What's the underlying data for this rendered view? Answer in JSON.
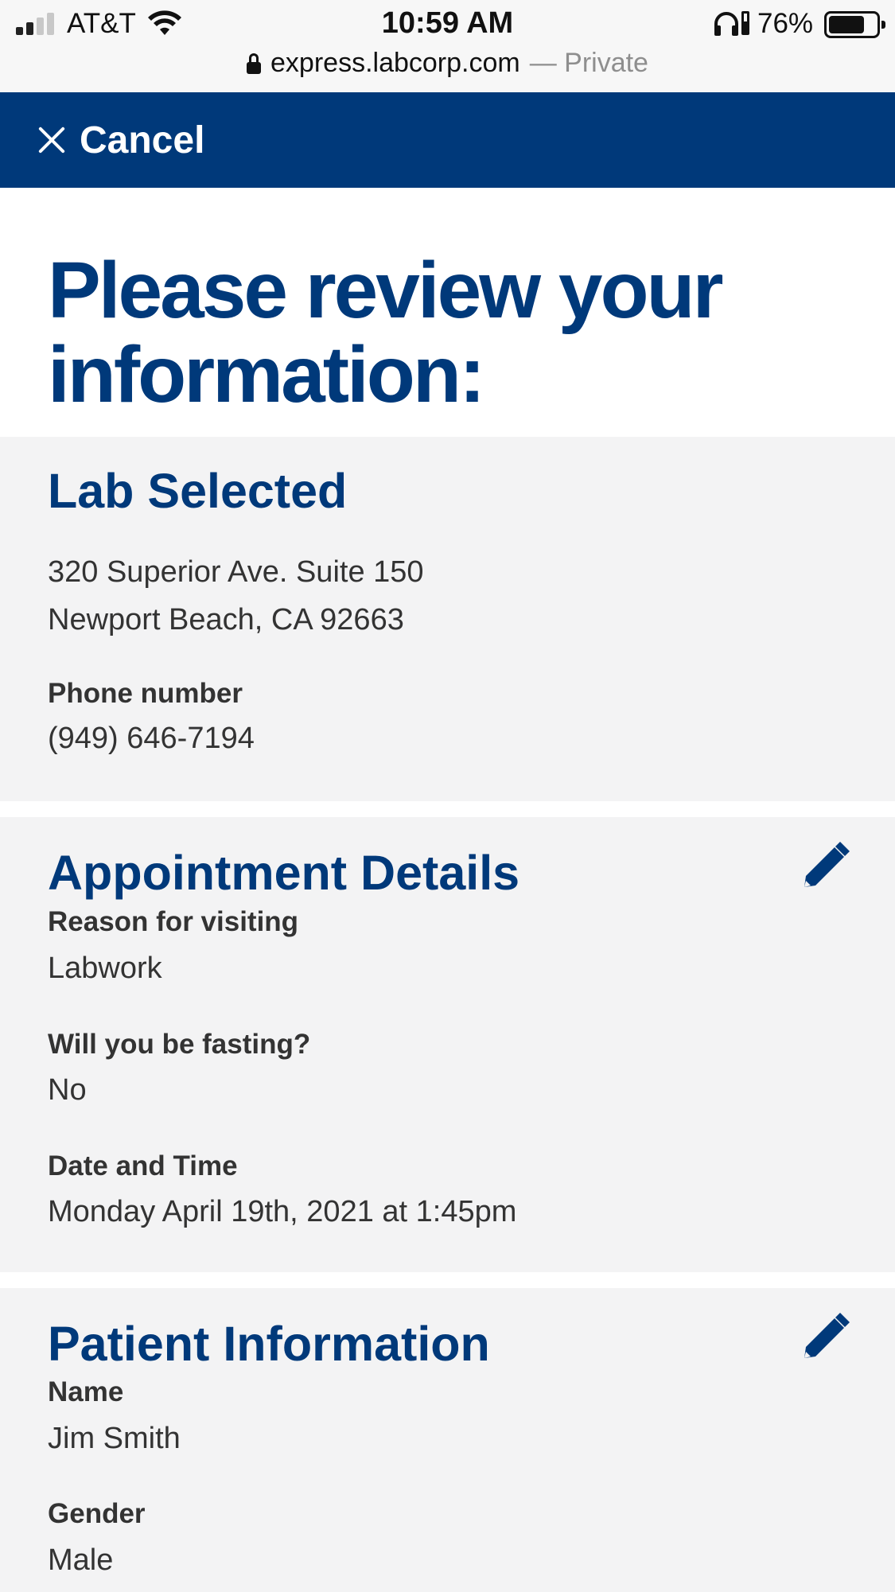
{
  "status_bar": {
    "carrier": "AT&T",
    "time": "10:59 AM",
    "battery_percent": "76%"
  },
  "browser": {
    "domain": "express.labcorp.com",
    "private_label": "— Private"
  },
  "header": {
    "cancel_label": "Cancel"
  },
  "page": {
    "title": "Please review your information:"
  },
  "lab_section": {
    "title": "Lab Selected",
    "address_line1": "320 Superior Ave. Suite 150",
    "address_line2": "Newport Beach, CA 92663",
    "phone_label": "Phone number",
    "phone_value": "(949) 646-7194"
  },
  "appointment_section": {
    "title": "Appointment Details",
    "reason_label": "Reason for visiting",
    "reason_value": "Labwork",
    "fasting_label": "Will you be fasting?",
    "fasting_value": "No",
    "datetime_label": "Date and Time",
    "datetime_value": "Monday April 19th, 2021 at 1:45pm"
  },
  "patient_section": {
    "title": "Patient Information",
    "name_label": "Name",
    "name_value": "Jim Smith",
    "gender_label": "Gender",
    "gender_value": "Male"
  },
  "icons": {
    "close": "close-icon",
    "edit": "pencil-icon",
    "lock": "lock-icon",
    "wifi": "wifi-icon",
    "signal": "signal-icon",
    "headphones": "headphones-icon",
    "battery": "battery-icon"
  },
  "colors": {
    "brand_blue": "#00397a",
    "section_bg": "#f3f3f4",
    "text": "#333333"
  }
}
